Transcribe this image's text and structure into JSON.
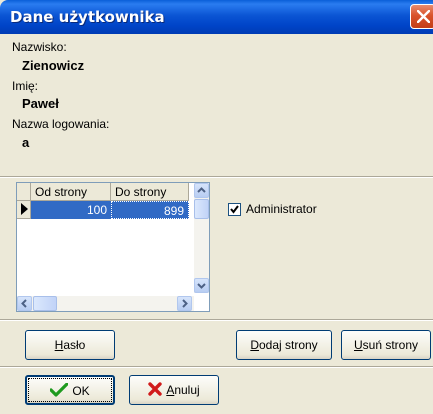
{
  "window": {
    "title": "Dane użytkownika"
  },
  "info": {
    "surname_label": "Nazwisko:",
    "surname_value": "Zienowicz",
    "firstname_label": "Imię:",
    "firstname_value": "Paweł",
    "login_label": "Nazwa logowania:",
    "login_value": "a"
  },
  "grid": {
    "columns": [
      "Od strony",
      "Do strony"
    ],
    "rows": [
      {
        "from": "100",
        "to": "899",
        "selected": true
      }
    ]
  },
  "admin_checkbox": {
    "label": "Administrator",
    "checked": true
  },
  "buttons": {
    "password": {
      "accel": "H",
      "rest": "asło"
    },
    "add_pages": {
      "accel": "D",
      "rest": "odaj strony"
    },
    "remove_pages": {
      "accel": "U",
      "rest": "suń strony"
    },
    "ok": {
      "label": "OK"
    },
    "cancel": {
      "accel": "A",
      "rest": "nuluj"
    }
  },
  "colors": {
    "selection": "#316ac5",
    "title_bar": "#0054e3",
    "dialog_bg": "#ece9d8"
  }
}
